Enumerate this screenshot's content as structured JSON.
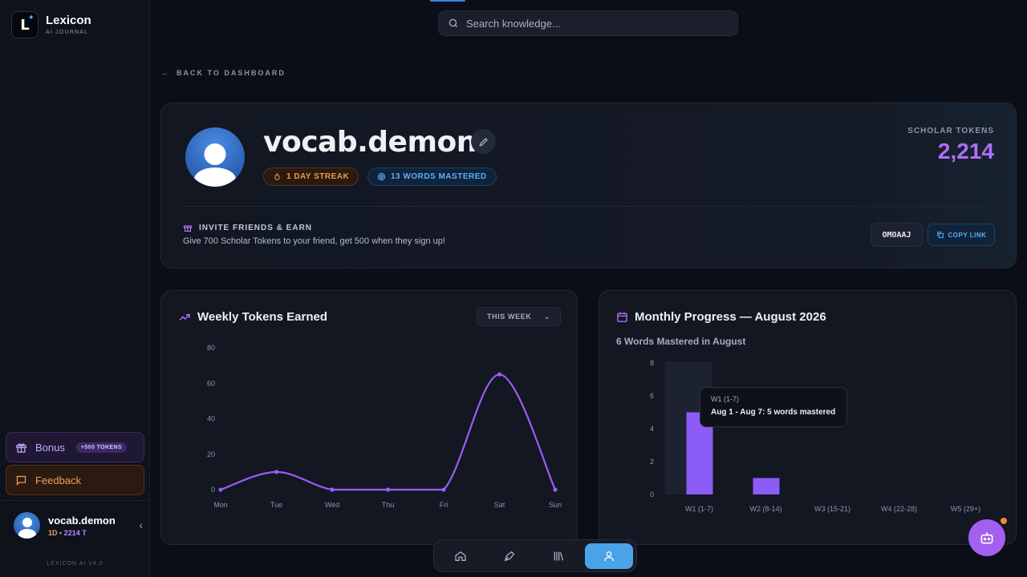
{
  "brand": {
    "name": "Lexicon",
    "subtitle": "AI JOURNAL",
    "logo_letter": "L"
  },
  "search": {
    "placeholder": "Search knowledge..."
  },
  "nav": {
    "back_label": "BACK TO DASHBOARD"
  },
  "sidebar": {
    "bonus_label": "Bonus",
    "bonus_badge": "+500 TOKENS",
    "feedback_label": "Feedback",
    "user": {
      "name": "vocab.demon",
      "streak": "1D",
      "tokens": "• 2214 T"
    },
    "version": "LEXICON AI V4.0"
  },
  "profile": {
    "username": "vocab.demon",
    "streak_badge": "1 DAY STREAK",
    "words_badge": "13 WORDS MASTERED",
    "scholar_label": "SCHOLAR TOKENS",
    "scholar_value": "2,214",
    "invite_title": "INVITE FRIENDS & EARN",
    "invite_desc": "Give 700 Scholar Tokens to your friend, get 500 when they sign up!",
    "referral_code": "OMOAAJ",
    "copy_label": "COPY LINK"
  },
  "weekly": {
    "title": "Weekly Tokens Earned",
    "range": "THIS WEEK"
  },
  "monthly": {
    "title": "Monthly Progress — August 2026",
    "subtitle": "6 Words Mastered in August",
    "tooltip": {
      "title": "W1 (1-7)",
      "body": "Aug 1 - Aug 7: 5 words mastered"
    }
  },
  "colors": {
    "accent": "#a35ff0",
    "line": "#9b5cf6",
    "bar": "#8b5cf6",
    "streak": "#f39a4a",
    "info": "#5ab0ff"
  },
  "chart_data": [
    {
      "type": "line",
      "title": "Weekly Tokens Earned",
      "categories": [
        "Mon",
        "Tue",
        "Wed",
        "Thu",
        "Fri",
        "Sat",
        "Sun"
      ],
      "values": [
        0,
        10,
        0,
        0,
        0,
        65,
        0
      ],
      "ylim": [
        0,
        80
      ],
      "yticks": [
        0,
        20,
        40,
        60,
        80
      ],
      "grid": false
    },
    {
      "type": "bar",
      "title": "Monthly Progress — August 2026",
      "categories": [
        "W1 (1-7)",
        "W2 (8-14)",
        "W3 (15-21)",
        "W4 (22-28)",
        "W5 (29+)"
      ],
      "values": [
        5,
        1,
        0,
        0,
        0
      ],
      "ylim": [
        0,
        8
      ],
      "yticks": [
        0,
        2,
        4,
        6,
        8
      ],
      "highlighted": "W1 (1-7)",
      "grid": false
    }
  ]
}
